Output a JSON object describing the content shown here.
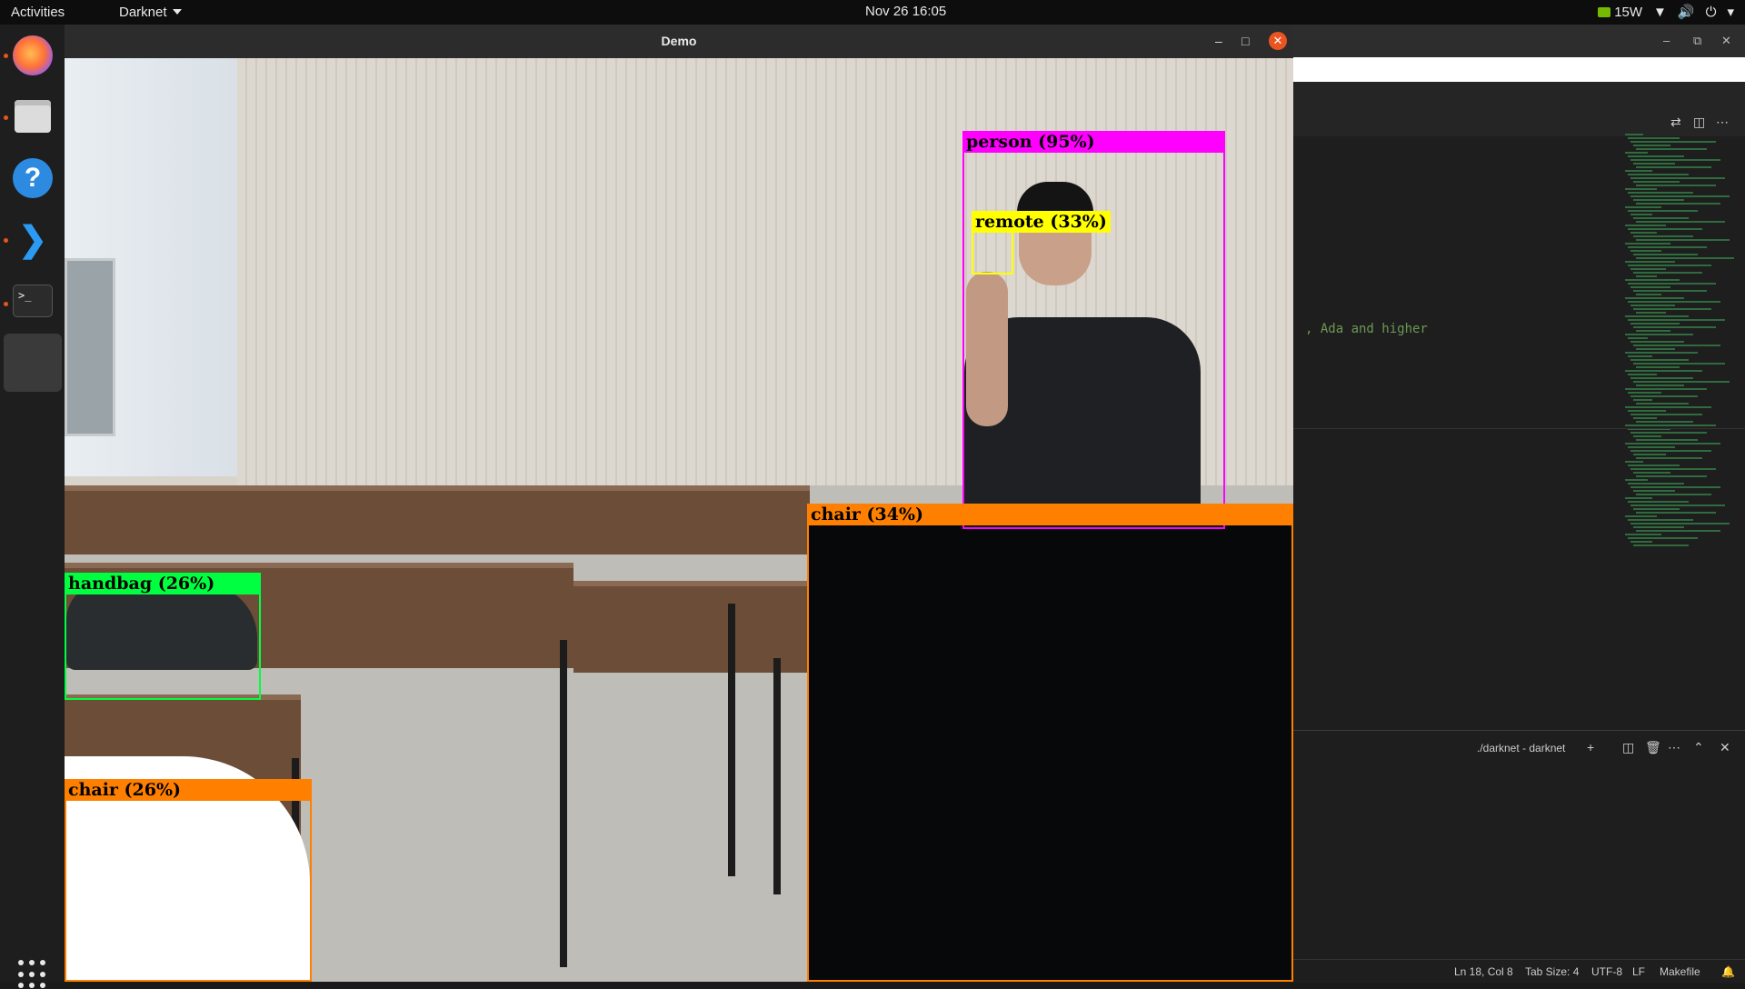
{
  "topbar": {
    "activities": "Activities",
    "app_name": "Darknet",
    "clock": "Nov 26  16:05",
    "power": "15W"
  },
  "dock": {
    "items": [
      "firefox-icon",
      "files-icon",
      "help-icon",
      "vscode-icon",
      "terminal-icon",
      "active-app-icon"
    ],
    "apps_grid": "show-apps-icon"
  },
  "demo_window": {
    "title": "Demo",
    "detections": [
      {
        "label": "person (95%)",
        "color": "#ff00ff"
      },
      {
        "label": "remote (33%)",
        "color": "#ffff00"
      },
      {
        "label": "chair (34%)",
        "color": "#ff8000"
      },
      {
        "label": "handbag (26%)",
        "color": "#00ff40"
      },
      {
        "label": "chair (26%)",
        "color": "#ff8000"
      }
    ]
  },
  "vscode": {
    "code_fragment": ", Ada and higher",
    "terminal_name": "./darknet - darknet",
    "status": {
      "position": "Ln 18, Col 8",
      "tab_size": "Tab Size: 4",
      "encoding": "UTF-8",
      "eol": "LF",
      "language": "Makefile"
    }
  },
  "colors": {
    "accent": "#e95420",
    "person": "#ff00ff",
    "remote": "#ffff00",
    "chair": "#ff8000",
    "handbag": "#00ff40"
  }
}
